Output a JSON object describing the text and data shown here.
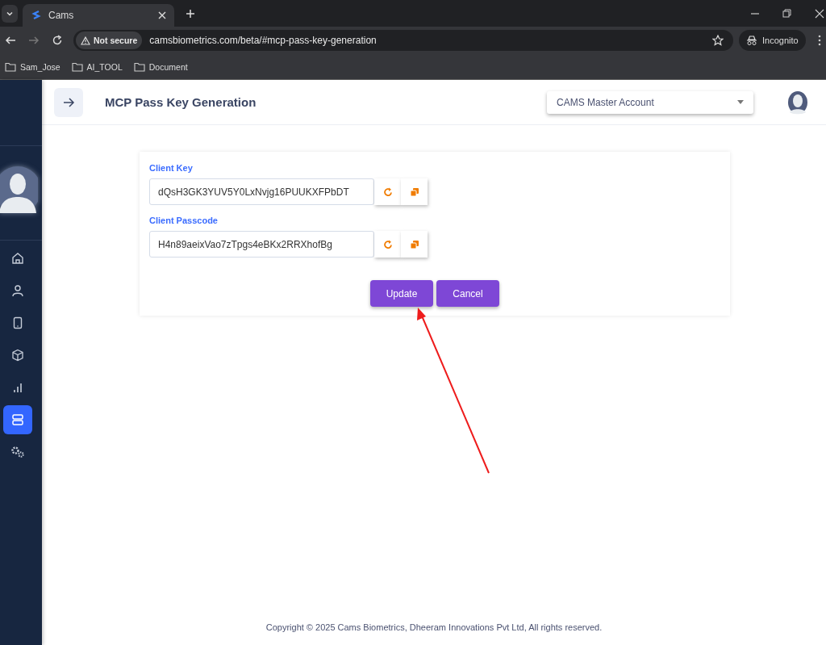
{
  "browser": {
    "tab": {
      "title": "Cams"
    },
    "security": "Not secure",
    "url": "camsbiometrics.com/beta/#mcp-pass-key-generation",
    "profile": "Incognito",
    "bookmarks": [
      "Sam_Jose",
      "AI_TOOL",
      "Document"
    ]
  },
  "sidebar": {
    "items": [
      {
        "kind": "home",
        "selected": false
      },
      {
        "kind": "user",
        "selected": false
      },
      {
        "kind": "tablet",
        "selected": false
      },
      {
        "kind": "cube",
        "selected": false
      },
      {
        "kind": "chart",
        "selected": false
      },
      {
        "kind": "server",
        "selected": true
      },
      {
        "kind": "gears",
        "selected": false
      }
    ]
  },
  "header": {
    "title": "MCP Pass Key Generation",
    "account": "CAMS Master Account"
  },
  "form": {
    "fields": [
      {
        "label": "Client Key",
        "value": "dQsH3GK3YUV5Y0LxNvjg16PUUKXFPbDT"
      },
      {
        "label": "Client Passcode",
        "value": "H4n89aeixVao7zTpgs4eBKx2RRXhofBg"
      }
    ],
    "buttons": [
      "Update",
      "Cancel"
    ]
  },
  "footer": "Copyright © 2025 Cams Biometrics, Dheeram Innovations Pvt Ltd, All rights reserved."
}
